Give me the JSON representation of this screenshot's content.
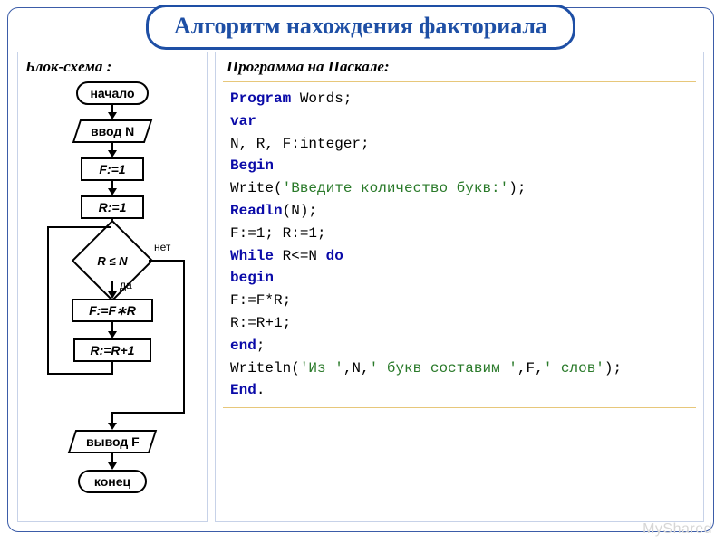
{
  "title": "Алгоритм нахождения факториала",
  "left": {
    "heading": "Блок-схема :",
    "nodes": {
      "start": "начало",
      "inputN": "ввод N",
      "f1": "F:=1",
      "r1": "R:=1",
      "cond": "R ≤ N",
      "yes": "да",
      "no": "нет",
      "fr": "F:=F∗R",
      "rinc": "R:=R+1",
      "outF": "вывод F",
      "end": "конец"
    }
  },
  "right": {
    "heading": "Программа на Паскале:",
    "code": {
      "l1_kw": "Program",
      "l1_rest": " Words;",
      "l2_kw": "var",
      "l3": "N, R, F:integer;",
      "l4_kw": "Begin",
      "l5_a": "Write(",
      "l5_str": "'Введите количество букв:'",
      "l5_b": ");",
      "l6_a": "Readln",
      "l6_b": "(N);",
      "l7": "F:=1; R:=1;",
      "l8_kw": "While",
      "l8_rest": " R<=N ",
      "l8_kw2": "do",
      "l9_kw": "begin",
      "l10": "F:=F*R;",
      "l11": "R:=R+1;",
      "l12_kw": "end",
      "l12_b": ";",
      "l13_a": "Writeln(",
      "l13_s1": "'Из '",
      "l13_m1": ",N,",
      "l13_s2": "' букв составим '",
      "l13_m2": ",F,",
      "l13_s3": "' слов'",
      "l13_b": ");",
      "l14_kw": "End",
      "l14_b": "."
    }
  },
  "watermark": "MyShared"
}
